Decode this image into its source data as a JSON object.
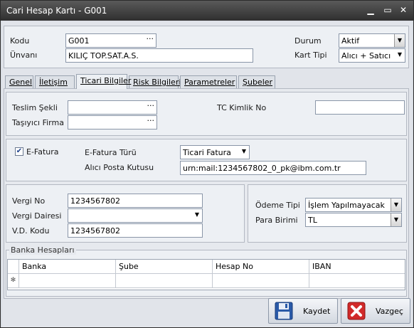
{
  "window": {
    "title": "Cari Hesap Kartı - G001"
  },
  "header": {
    "kodu_label": "Kodu",
    "kodu_value": "G001",
    "unvani_label": "Ünvanı",
    "unvani_value": "KILIÇ TOP.SAT.A.S.",
    "durum_label": "Durum",
    "durum_value": "Aktif",
    "kart_tipi_label": "Kart Tipi",
    "kart_tipi_value": "Alıcı + Satıcı"
  },
  "tabs": [
    "Genel",
    "İletişim",
    "Ticari Bilgiler",
    "Risk Bilgileri",
    "Parametreler",
    "Şubeler"
  ],
  "active_tab": "Ticari Bilgiler",
  "ticari": {
    "teslim_sekli_label": "Teslim Şekli",
    "teslim_sekli_value": "",
    "tasiyici_firma_label": "Taşıyıcı Firma",
    "tasiyici_firma_value": "",
    "tc_kimlik_label": "TC Kimlik No",
    "tc_kimlik_value": "",
    "efatura_label": "E-Fatura",
    "efatura_checked": true,
    "efatura_turu_label": "E-Fatura Türü",
    "efatura_turu_value": "Ticari Fatura",
    "alici_posta_label": "Alıcı Posta Kutusu",
    "alici_posta_value": "urn:mail:1234567802_0_pk@ibm.com.tr",
    "vergi_no_label": "Vergi No",
    "vergi_no_value": "1234567802",
    "vergi_dairesi_label": "Vergi Dairesi",
    "vergi_dairesi_value": "",
    "vd_kodu_label": "V.D. Kodu",
    "vd_kodu_value": "1234567802",
    "odeme_tipi_label": "Ödeme Tipi",
    "odeme_tipi_value": "İşlem Yapılmayacak",
    "para_birimi_label": "Para Birimi",
    "para_birimi_value": "TL"
  },
  "banka": {
    "title": "Banka Hesapları",
    "columns": [
      "Banka",
      "Şube",
      "Hesap No",
      "IBAN"
    ],
    "new_row_marker": "✻"
  },
  "buttons": {
    "kaydet": "Kaydet",
    "vazgec": "Vazgeç"
  },
  "colors": {
    "titlebar": "#3a3a3a",
    "panel": "#edf0f4",
    "save_icon": "#2a5aa8",
    "cancel_icon": "#d12a2a"
  }
}
